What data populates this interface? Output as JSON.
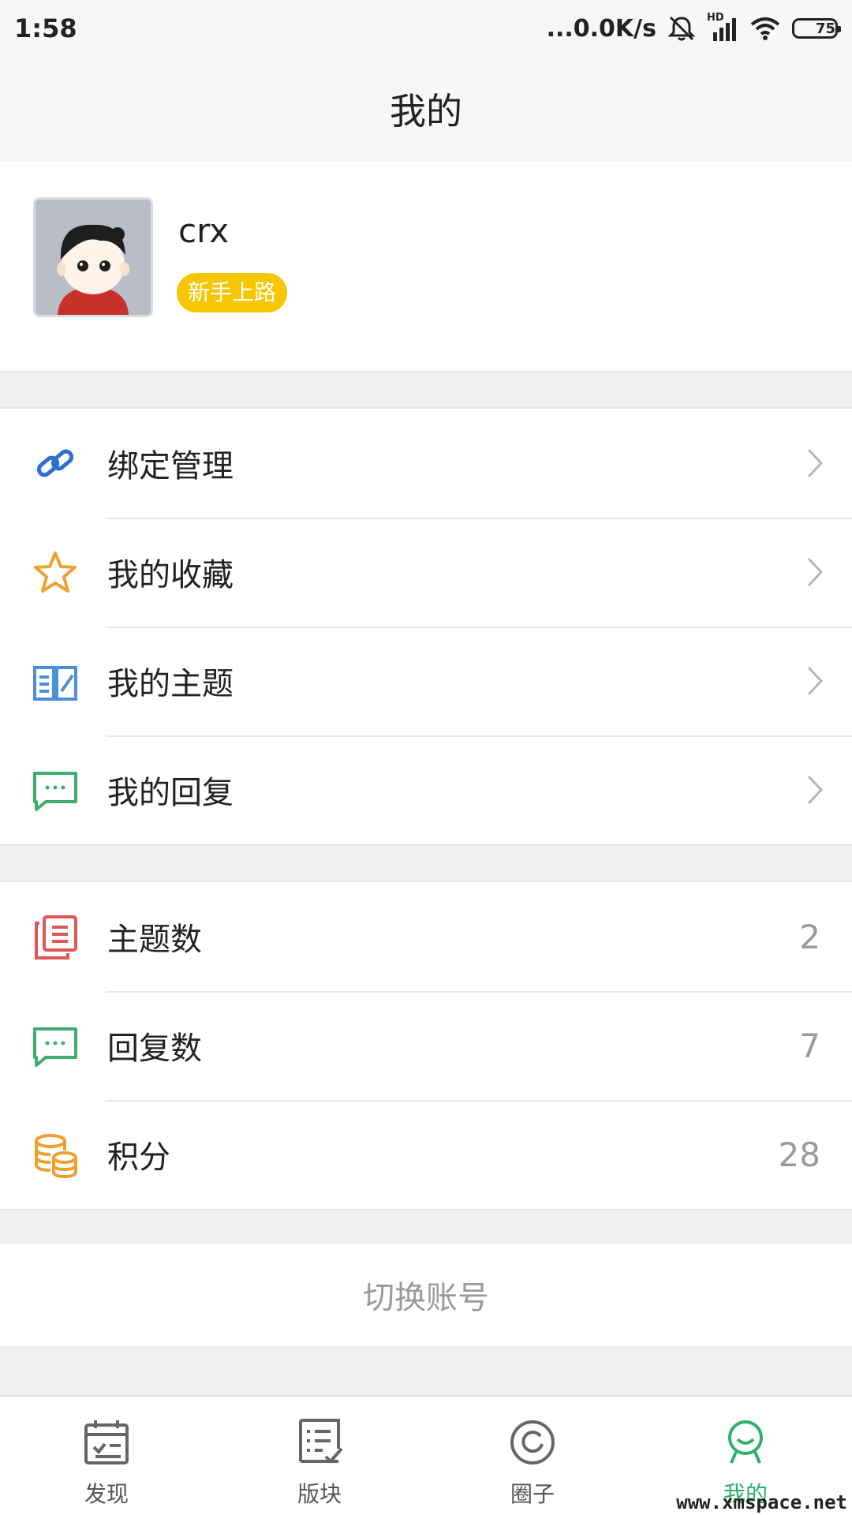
{
  "status": {
    "time": "1:58",
    "network_speed": "...0.0K/s",
    "signal_label": "HD",
    "battery_level": "75",
    "battery_fraction": 0.75,
    "icons": [
      "silent-mode-icon",
      "signal-icon",
      "wifi-icon",
      "battery-icon"
    ]
  },
  "header": {
    "title": "我的"
  },
  "profile": {
    "username": "crx",
    "level_badge": "新手上路",
    "badge_color": "#f6c600"
  },
  "menu": [
    {
      "label": "绑定管理",
      "icon": "link-icon",
      "color": "#2f6fcf"
    },
    {
      "label": "我的收藏",
      "icon": "star-icon",
      "color": "#f0a030"
    },
    {
      "label": "我的主题",
      "icon": "book-icon",
      "color": "#4a90d9"
    },
    {
      "label": "我的回复",
      "icon": "chat-icon",
      "color": "#3fae6a"
    }
  ],
  "stats": [
    {
      "label": "主题数",
      "value": "2",
      "icon": "topics-icon",
      "color": "#e05555"
    },
    {
      "label": "回复数",
      "value": "7",
      "icon": "chat-icon",
      "color": "#3fae6a"
    },
    {
      "label": "积分",
      "value": "28",
      "icon": "coins-icon",
      "color": "#f0a030"
    }
  ],
  "switch_account": {
    "label": "切换账号"
  },
  "tabs": [
    {
      "label": "发现",
      "icon": "calendar-icon",
      "active": false
    },
    {
      "label": "版块",
      "icon": "list-icon",
      "active": false
    },
    {
      "label": "圈子",
      "icon": "circle-icon",
      "active": false
    },
    {
      "label": "我的",
      "icon": "person-icon",
      "active": true
    }
  ],
  "colors": {
    "accent": "#2db069",
    "muted": "#9a9a9a"
  },
  "watermark": "www.xmspace.net"
}
